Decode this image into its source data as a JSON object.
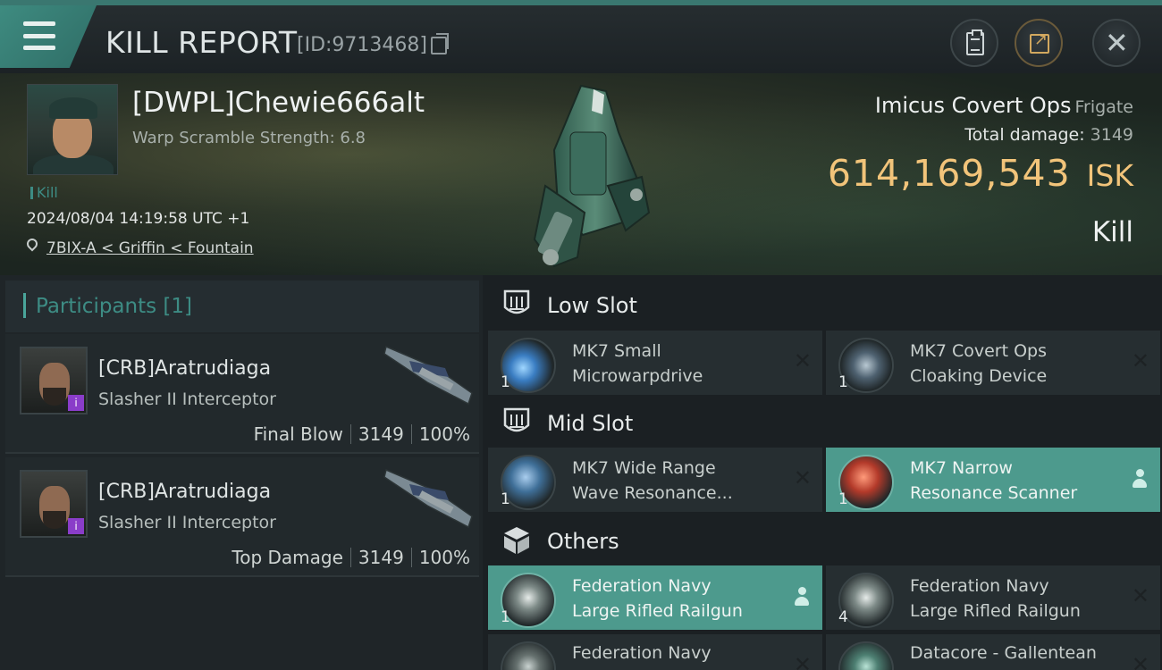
{
  "header": {
    "title": "KILL REPORT",
    "kill_id": "[ID:9713468]"
  },
  "victim": {
    "pilot": "[DWPL]Chewie666alt",
    "warp_scramble": "Warp Scramble Strength: 6.8",
    "tag": "Kill",
    "datetime": "2024/08/04 14:19:58 UTC +1",
    "location": "7BIX-A < Griffin < Fountain",
    "ship_name": "Imicus Covert Ops",
    "ship_class": "Frigate",
    "total_damage_label": "Total damage:",
    "total_damage": "3149",
    "isk_amount": "614,169,543",
    "isk_label": "ISK",
    "result": "Kill"
  },
  "participants": {
    "label": "Participants [1]",
    "items": [
      {
        "name": "[CRB]Aratrudiaga",
        "ship": "Slasher II Interceptor",
        "role": "Final Blow",
        "damage": "3149",
        "percent": "100%"
      },
      {
        "name": "[CRB]Aratrudiaga",
        "ship": "Slasher II Interceptor",
        "role": "Top Damage",
        "damage": "3149",
        "percent": "100%"
      }
    ]
  },
  "slots": {
    "low": {
      "label": "Low Slot",
      "modules": [
        {
          "qty": "1",
          "line1": "MK7 Small",
          "line2": "Microwarpdrive",
          "active": false
        },
        {
          "qty": "1",
          "line1": "MK7 Covert Ops",
          "line2": "Cloaking Device",
          "active": false
        }
      ]
    },
    "mid": {
      "label": "Mid Slot",
      "modules": [
        {
          "qty": "1",
          "line1": "MK7 Wide Range",
          "line2": "Wave Resonance...",
          "active": false
        },
        {
          "qty": "1",
          "line1": "MK7 Narrow",
          "line2": "Resonance Scanner",
          "active": true
        }
      ]
    },
    "others": {
      "label": "Others",
      "modules": [
        {
          "qty": "1",
          "line1": "Federation Navy",
          "line2": "Large Rifled Railgun",
          "active": true
        },
        {
          "qty": "4",
          "line1": "Federation Navy",
          "line2": "Large Rifled Railgun",
          "active": false
        },
        {
          "qty": "",
          "line1": "Federation Navy",
          "line2": "",
          "active": false
        },
        {
          "qty": "",
          "line1": "Datacore - Gallentean",
          "line2": "",
          "active": false
        }
      ]
    }
  },
  "icons": {
    "menu": "hamburger-menu-icon",
    "copy": "copy-icon",
    "clipboard": "clipboard-icon",
    "share": "share-icon",
    "close": "close-icon",
    "location": "location-pin-icon",
    "low_slot": "low-slot-icon",
    "mid_slot": "mid-slot-icon",
    "others": "cube-icon",
    "dropped": "person-icon",
    "destroyed": "x-icon"
  },
  "colors": {
    "accent": "#3d8c84",
    "isk": "#f2c47a",
    "active_module": "#4d9a8d",
    "corp_badge": "#8a3dc9"
  }
}
